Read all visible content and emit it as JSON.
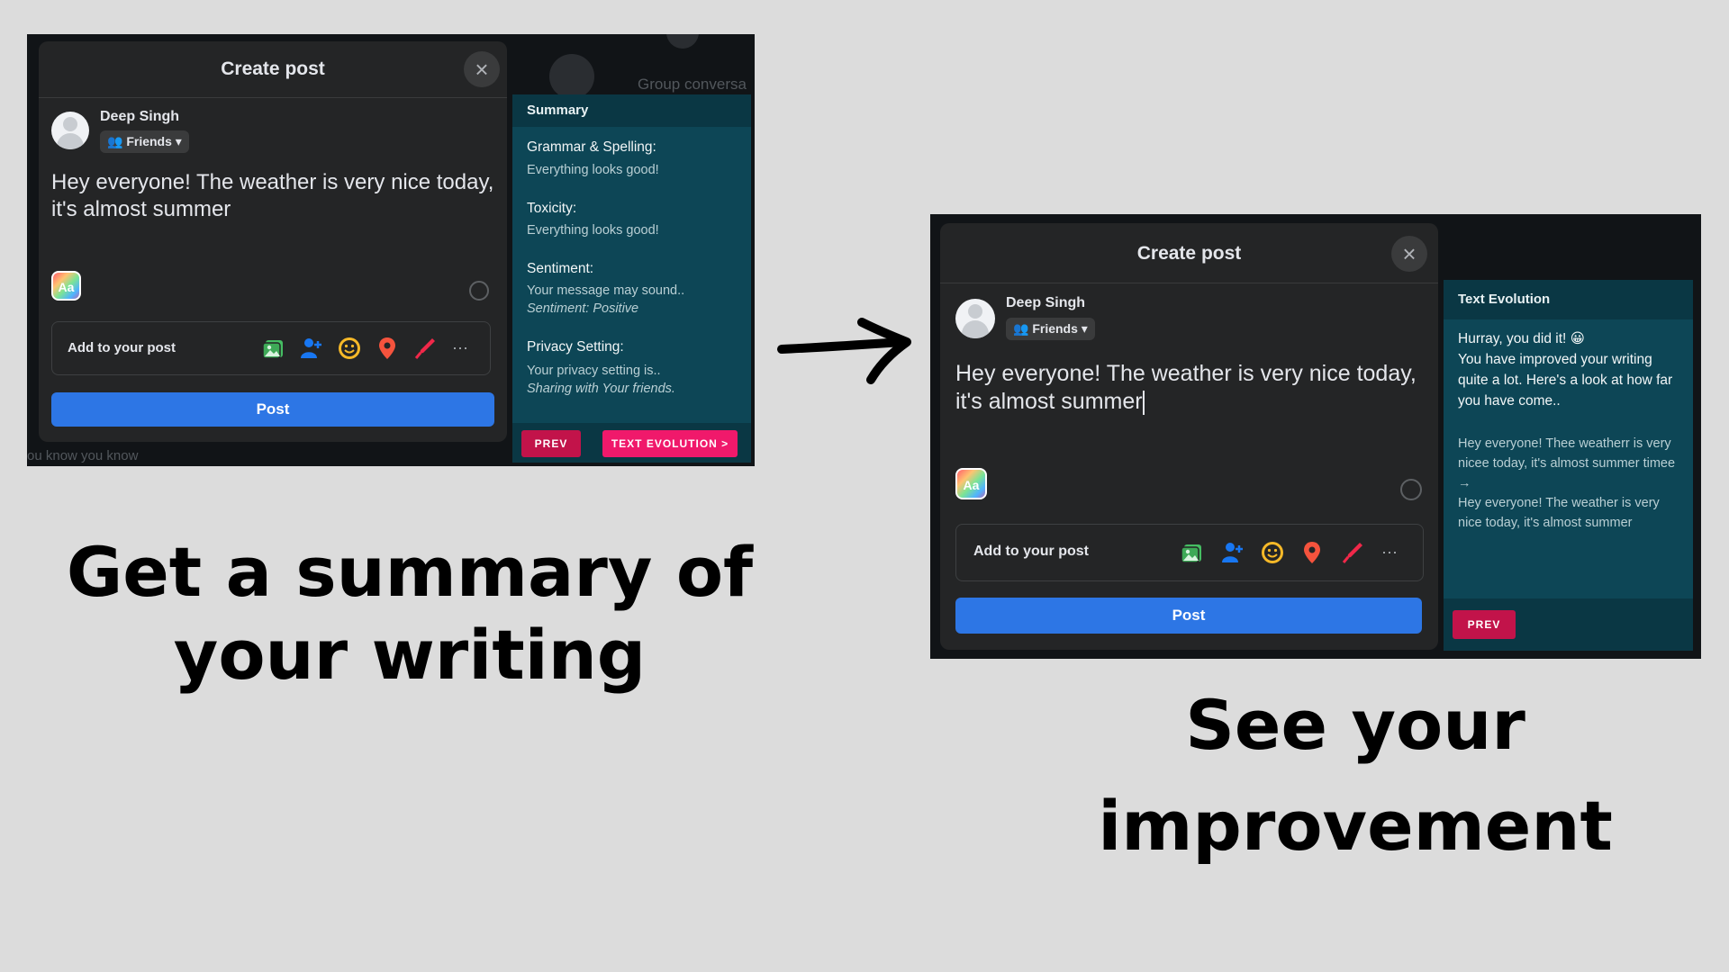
{
  "left": {
    "background": {
      "right_text": "Group conversa",
      "bottom_text": "ou know you know"
    },
    "modal": {
      "title": "Create post",
      "user_name": "Deep Singh",
      "privacy": "Friends",
      "post_text": "Hey everyone! The weather is very nice today, it's almost summer",
      "add_to_post": "Add to your post",
      "post_button": "Post"
    },
    "summary": {
      "header": "Summary",
      "sections": [
        {
          "title": "Grammar & Spelling:",
          "body": "Everything looks good!",
          "note": ""
        },
        {
          "title": "Toxicity:",
          "body": "Everything looks good!",
          "note": ""
        },
        {
          "title": "Sentiment:",
          "body": "Your message may sound..",
          "note": "Sentiment: Positive"
        },
        {
          "title": "Privacy Setting:",
          "body": "Your privacy setting is..",
          "note": "Sharing with Your friends."
        }
      ],
      "prev_button": "PREV",
      "next_button": "TEXT EVOLUTION >"
    },
    "caption_line1": "Get a summary of",
    "caption_line2": "your writing"
  },
  "right": {
    "modal": {
      "title": "Create post",
      "user_name": "Deep Singh",
      "privacy": "Friends",
      "post_text": "Hey everyone! The weather is very nice today, it's almost summer",
      "add_to_post": "Add to your post",
      "post_button": "Post"
    },
    "evolution": {
      "header": "Text Evolution",
      "cheer": "Hurray, you did it! 😀",
      "intro": "You have improved your writing quite a lot. Here's a look at how far you have come..",
      "before": "Hey everyone! Thee weatherr is very nicee today, it's almost summer timee",
      "arrow": "→",
      "after": "Hey everyone! The weather is very nice today, it's almost summer",
      "prev_button": "PREV"
    },
    "caption_line1": "See your",
    "caption_line2": "improvement"
  },
  "icons": [
    "close-icon",
    "friends-icon",
    "caret-down-icon",
    "text-style-icon",
    "emoji-icon",
    "photo-icon",
    "tag-people-icon",
    "feeling-icon",
    "location-icon",
    "live-icon",
    "more-icon",
    "arrow-icon"
  ],
  "colors": {
    "post_button": "#2d76e5",
    "panel": "#0d4656",
    "prev_button": "#c2134a",
    "next_button": "#f0196b",
    "modal": "#242526"
  }
}
